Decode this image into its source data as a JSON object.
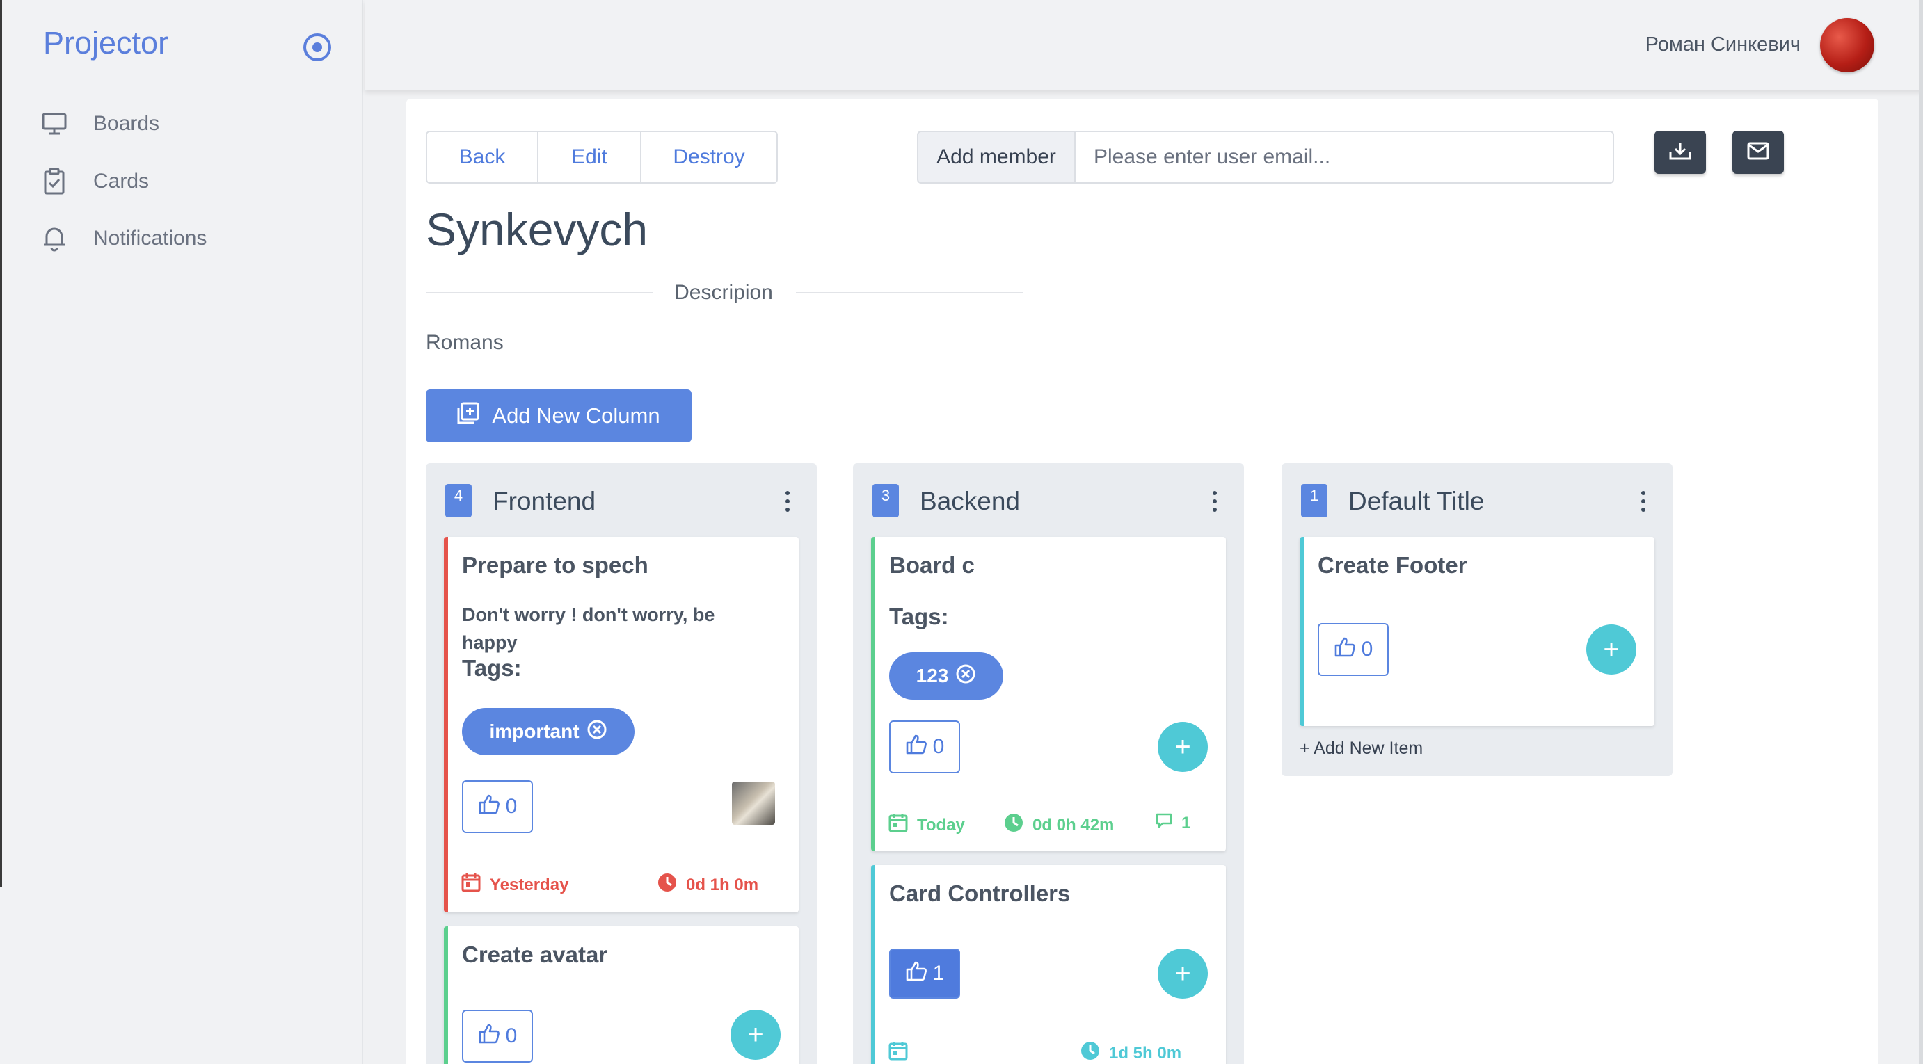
{
  "app": {
    "brand": "Projector"
  },
  "sidebar": {
    "items": [
      {
        "label": "Boards",
        "icon": "monitor-icon"
      },
      {
        "label": "Cards",
        "icon": "clipboard-check-icon"
      },
      {
        "label": "Notifications",
        "icon": "bell-icon"
      }
    ]
  },
  "user": {
    "name": "Роман Синкевич"
  },
  "toolbar": {
    "back_label": "Back",
    "edit_label": "Edit",
    "destroy_label": "Destroy",
    "add_member_label": "Add member",
    "email_placeholder": "Please enter user email..."
  },
  "board": {
    "title": "Synkevych",
    "description_label": "Descripion",
    "description": "Romans",
    "add_column_label": "Add New Column"
  },
  "columns": [
    {
      "count": "4",
      "title": "Frontend",
      "cards": [
        {
          "title": "Prepare to spech",
          "description": "Don't worry ! don't worry, be happy",
          "tags_label": "Tags:",
          "tags": [
            "important"
          ],
          "likes": "0",
          "date": "Yesterday",
          "time": "0d 1h 0m",
          "accent": "#e5534b"
        },
        {
          "title": "Create avatar",
          "likes": "0",
          "accent": "#5ccf8e"
        }
      ]
    },
    {
      "count": "3",
      "title": "Backend",
      "cards": [
        {
          "title": "Board c",
          "tags_label": "Tags:",
          "tags": [
            "123"
          ],
          "likes": "0",
          "date": "Today",
          "time": "0d 0h 42m",
          "comments": "1",
          "accent": "#5ccf8e"
        },
        {
          "title": "Card Controllers",
          "likes": "1",
          "time": "1d 5h 0m",
          "accent": "#4fc9d6"
        }
      ]
    },
    {
      "count": "1",
      "title": "Default Title",
      "cards": [
        {
          "title": "Create Footer",
          "likes": "0",
          "accent": "#4fc9d6"
        }
      ],
      "add_item_label": "+ Add New Item"
    }
  ],
  "colors": {
    "accent": "#5b86e0",
    "danger": "#e5534b",
    "success": "#5ccf8e",
    "info": "#4fc9d6"
  }
}
